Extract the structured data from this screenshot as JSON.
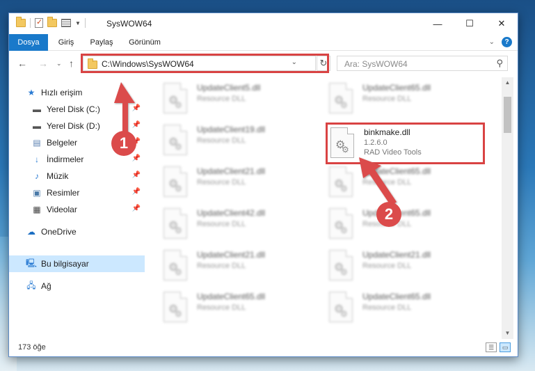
{
  "window": {
    "title": "SysWOW64"
  },
  "ribbon": {
    "tabs": [
      "Dosya",
      "Giriş",
      "Paylaş",
      "Görünüm"
    ]
  },
  "address": {
    "path": "C:\\Windows\\SysWOW64",
    "search_placeholder": "Ara: SysWOW64"
  },
  "sidebar": {
    "items": [
      {
        "label": "Hızlı erişim",
        "icon": "star-icon"
      },
      {
        "label": "Yerel Disk (C:)",
        "icon": "drive-icon",
        "pinned": true
      },
      {
        "label": "Yerel Disk (D:)",
        "icon": "drive-icon",
        "pinned": true
      },
      {
        "label": "Belgeler",
        "icon": "documents-icon",
        "pinned": true
      },
      {
        "label": "İndirmeler",
        "icon": "downloads-icon",
        "pinned": true
      },
      {
        "label": "Müzik",
        "icon": "music-icon",
        "pinned": true
      },
      {
        "label": "Resimler",
        "icon": "pictures-icon",
        "pinned": true
      },
      {
        "label": "Videolar",
        "icon": "videos-icon",
        "pinned": true
      },
      {
        "label": "OneDrive",
        "icon": "cloud-icon"
      },
      {
        "label": "Bu bilgisayar",
        "icon": "computer-icon",
        "selected": true
      },
      {
        "label": "Ağ",
        "icon": "network-icon"
      }
    ]
  },
  "files": {
    "col1": [
      {
        "name": "UpdateClient5.dll",
        "type": "Resource DLL"
      },
      {
        "name": "UpdateClient19.dll",
        "type": "Resource DLL"
      },
      {
        "name": "UpdateClient21.dll",
        "type": "Resource DLL"
      },
      {
        "name": "UpdateClient42.dll",
        "type": "Resource DLL"
      },
      {
        "name": "UpdateClient21.dll",
        "type": "Resource DLL"
      },
      {
        "name": "UpdateClient65.dll",
        "type": "Resource DLL"
      }
    ],
    "col2": [
      {
        "name": "UpdateClient65.dll",
        "type": "Resource DLL"
      },
      {
        "name": "binkmake.dll",
        "version": "1.2.6.0",
        "company": "RAD Video Tools",
        "highlighted": true
      },
      {
        "name": "UpdateClient65.dll",
        "type": "Resource DLL"
      },
      {
        "name": "UpdateClient65.dll",
        "type": "Resource DLL"
      },
      {
        "name": "UpdateClient21.dll",
        "type": "Resource DLL"
      },
      {
        "name": "UpdateClient65.dll",
        "type": "Resource DLL"
      }
    ]
  },
  "status": {
    "item_count": "173 öğe"
  },
  "annotations": {
    "callout_1": "1",
    "callout_2": "2",
    "color": "#db4b4b"
  }
}
